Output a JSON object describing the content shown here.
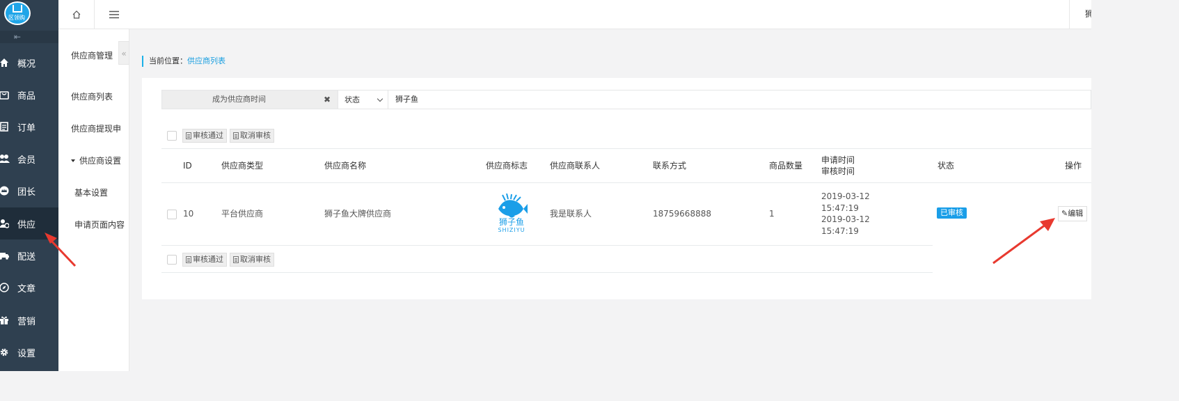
{
  "brand": {
    "logo_text": "区领购"
  },
  "nav": {
    "items": [
      {
        "label": "概况",
        "icon": "home-icon"
      },
      {
        "label": "商品",
        "icon": "bag-icon"
      },
      {
        "label": "订单",
        "icon": "document-icon"
      },
      {
        "label": "会员",
        "icon": "users-icon"
      },
      {
        "label": "团长",
        "icon": "crown-icon"
      },
      {
        "label": "供应",
        "icon": "supplier-icon"
      },
      {
        "label": "配送",
        "icon": "truck-icon"
      },
      {
        "label": "文章",
        "icon": "compass-icon"
      },
      {
        "label": "营销",
        "icon": "gift-icon"
      },
      {
        "label": "设置",
        "icon": "gear-icon"
      }
    ],
    "active": "供应"
  },
  "submenu": {
    "title": "供应商管理",
    "collapse_glyph": "«",
    "items": [
      "供应商列表",
      "供应商提现申",
      "供应商设置"
    ],
    "children": [
      "基本设置",
      "申请页面内容"
    ]
  },
  "topbar": {
    "user_label": "狮"
  },
  "breadcrumb": {
    "prefix": "当前位置：",
    "current": "供应商列表"
  },
  "filter": {
    "date_placeholder": "成为供应商时间",
    "clear_glyph": "✖",
    "status_value": "状态",
    "keyword_value": "狮子鱼"
  },
  "bulk": {
    "approve": "审核通过",
    "cancel": "取消审核"
  },
  "table": {
    "headers": {
      "id": "ID",
      "type": "供应商类型",
      "name": "供应商名称",
      "logo": "供应商标志",
      "contact": "供应商联系人",
      "phone": "联系方式",
      "count": "商品数量",
      "time1": "申请时间",
      "time2": "审核时间",
      "status": "状态",
      "action": "操作"
    },
    "rows": [
      {
        "id": "10",
        "type": "平台供应商",
        "name": "狮子鱼大牌供应商",
        "logo_cn": "狮子鱼",
        "logo_en": "SHIZIYU",
        "contact": "我是联系人",
        "phone": "18759668888",
        "count": "1",
        "apply_date": "2019-03-12",
        "apply_time": "15:47:19",
        "review_date": "2019-03-12",
        "review_time": "15:47:19",
        "status": "已审核",
        "action": "编辑"
      }
    ]
  },
  "colors": {
    "nav_bg": "#2f4050",
    "accent": "#1a9ee8",
    "annotation_arrow": "#e8392f"
  }
}
